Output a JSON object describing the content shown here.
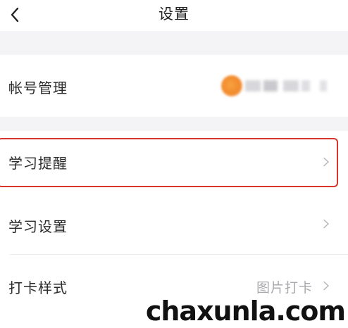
{
  "header": {
    "title": "设置",
    "back_icon": "chevron-left-icon"
  },
  "settings": {
    "account": {
      "label": "帐号管理",
      "avatar_color": "#f28a2d",
      "value_note": "blurred account name"
    },
    "study_reminder": {
      "label": "学习提醒",
      "highlighted": true,
      "highlight_color": "#d9342b"
    },
    "study_settings": {
      "label": "学习设置"
    },
    "checkin_style": {
      "label": "打卡样式",
      "value": "图片打卡"
    }
  },
  "watermark": {
    "text": "chaxunla.com"
  }
}
